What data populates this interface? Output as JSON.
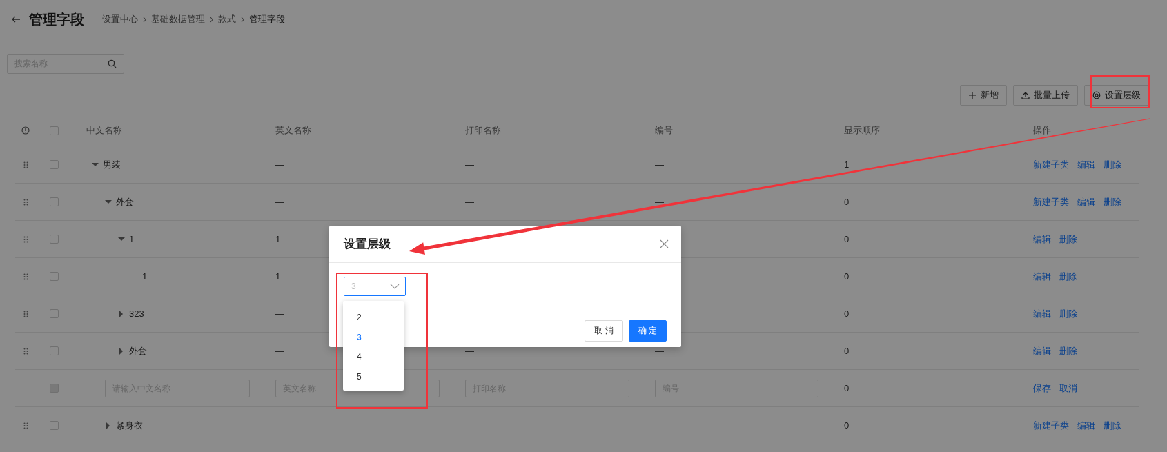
{
  "header": {
    "title": "管理字段",
    "breadcrumb": [
      "设置中心",
      "基础数据管理",
      "款式",
      "管理字段"
    ]
  },
  "search": {
    "placeholder": "搜索名称"
  },
  "toolbar": [
    {
      "kind": "add",
      "label": "新增"
    },
    {
      "kind": "upload",
      "label": "批量上传"
    },
    {
      "kind": "levels",
      "label": "设置层级"
    }
  ],
  "table": {
    "header_checked": false,
    "columns": [
      "中文名称",
      "英文名称",
      "打印名称",
      "编号",
      "显示顺序",
      "操作"
    ],
    "rows": [
      {
        "kind": "node",
        "name": "男装",
        "expanded": true,
        "checked": false,
        "english": "—",
        "print_name": "—",
        "code": "—",
        "order": "1",
        "actions": [
          "新建子类",
          "编辑",
          "删除"
        ],
        "children": [
          {
            "kind": "node",
            "name": "外套",
            "expanded": true,
            "checked": false,
            "english": "—",
            "print_name": "—",
            "code": "—",
            "order": "0",
            "actions": [
              "新建子类",
              "编辑",
              "删除"
            ],
            "children": [
              {
                "kind": "node",
                "name": "1",
                "expanded": true,
                "checked": false,
                "english": "1",
                "order": "0",
                "actions": [
                  "编辑",
                  "删除"
                ],
                "children": [
                  {
                    "kind": "node",
                    "name": "1",
                    "checked": false,
                    "english": "1",
                    "order": "0",
                    "actions": [
                      "编辑",
                      "删除"
                    ]
                  }
                ]
              },
              {
                "kind": "node",
                "name": "323",
                "expanded": false,
                "checked": false,
                "english": "—",
                "order": "0",
                "actions": [
                  "编辑",
                  "删除"
                ]
              },
              {
                "kind": "node",
                "name": "外套",
                "expanded": false,
                "checked": false,
                "english": "—",
                "print_name": "—",
                "code": "—",
                "order": "0",
                "actions": [
                  "编辑",
                  "删除"
                ]
              }
            ]
          },
          {
            "kind": "new",
            "disabled": true,
            "placeholders": [
              "请输入中文名称",
              "英文名称",
              "打印名称",
              "编号"
            ],
            "order": "0",
            "actions": [
              "保存",
              "取消"
            ]
          },
          {
            "kind": "node",
            "name": "紧身衣",
            "expanded": false,
            "checked": false,
            "english": "—",
            "print_name": "—",
            "code": "—",
            "order": "0",
            "actions": [
              "新建子类",
              "编辑",
              "删除"
            ]
          }
        ]
      }
    ]
  },
  "modal": {
    "title": "设置层级",
    "select": {
      "value": "3",
      "options": [
        {
          "label": "2",
          "selected": false
        },
        {
          "label": "3",
          "selected": true
        },
        {
          "label": "4",
          "selected": false
        },
        {
          "label": "5",
          "selected": false
        }
      ]
    },
    "buttons": [
      {
        "kind": "default",
        "label": "取 消"
      },
      {
        "kind": "primary",
        "label": "确 定"
      }
    ]
  }
}
